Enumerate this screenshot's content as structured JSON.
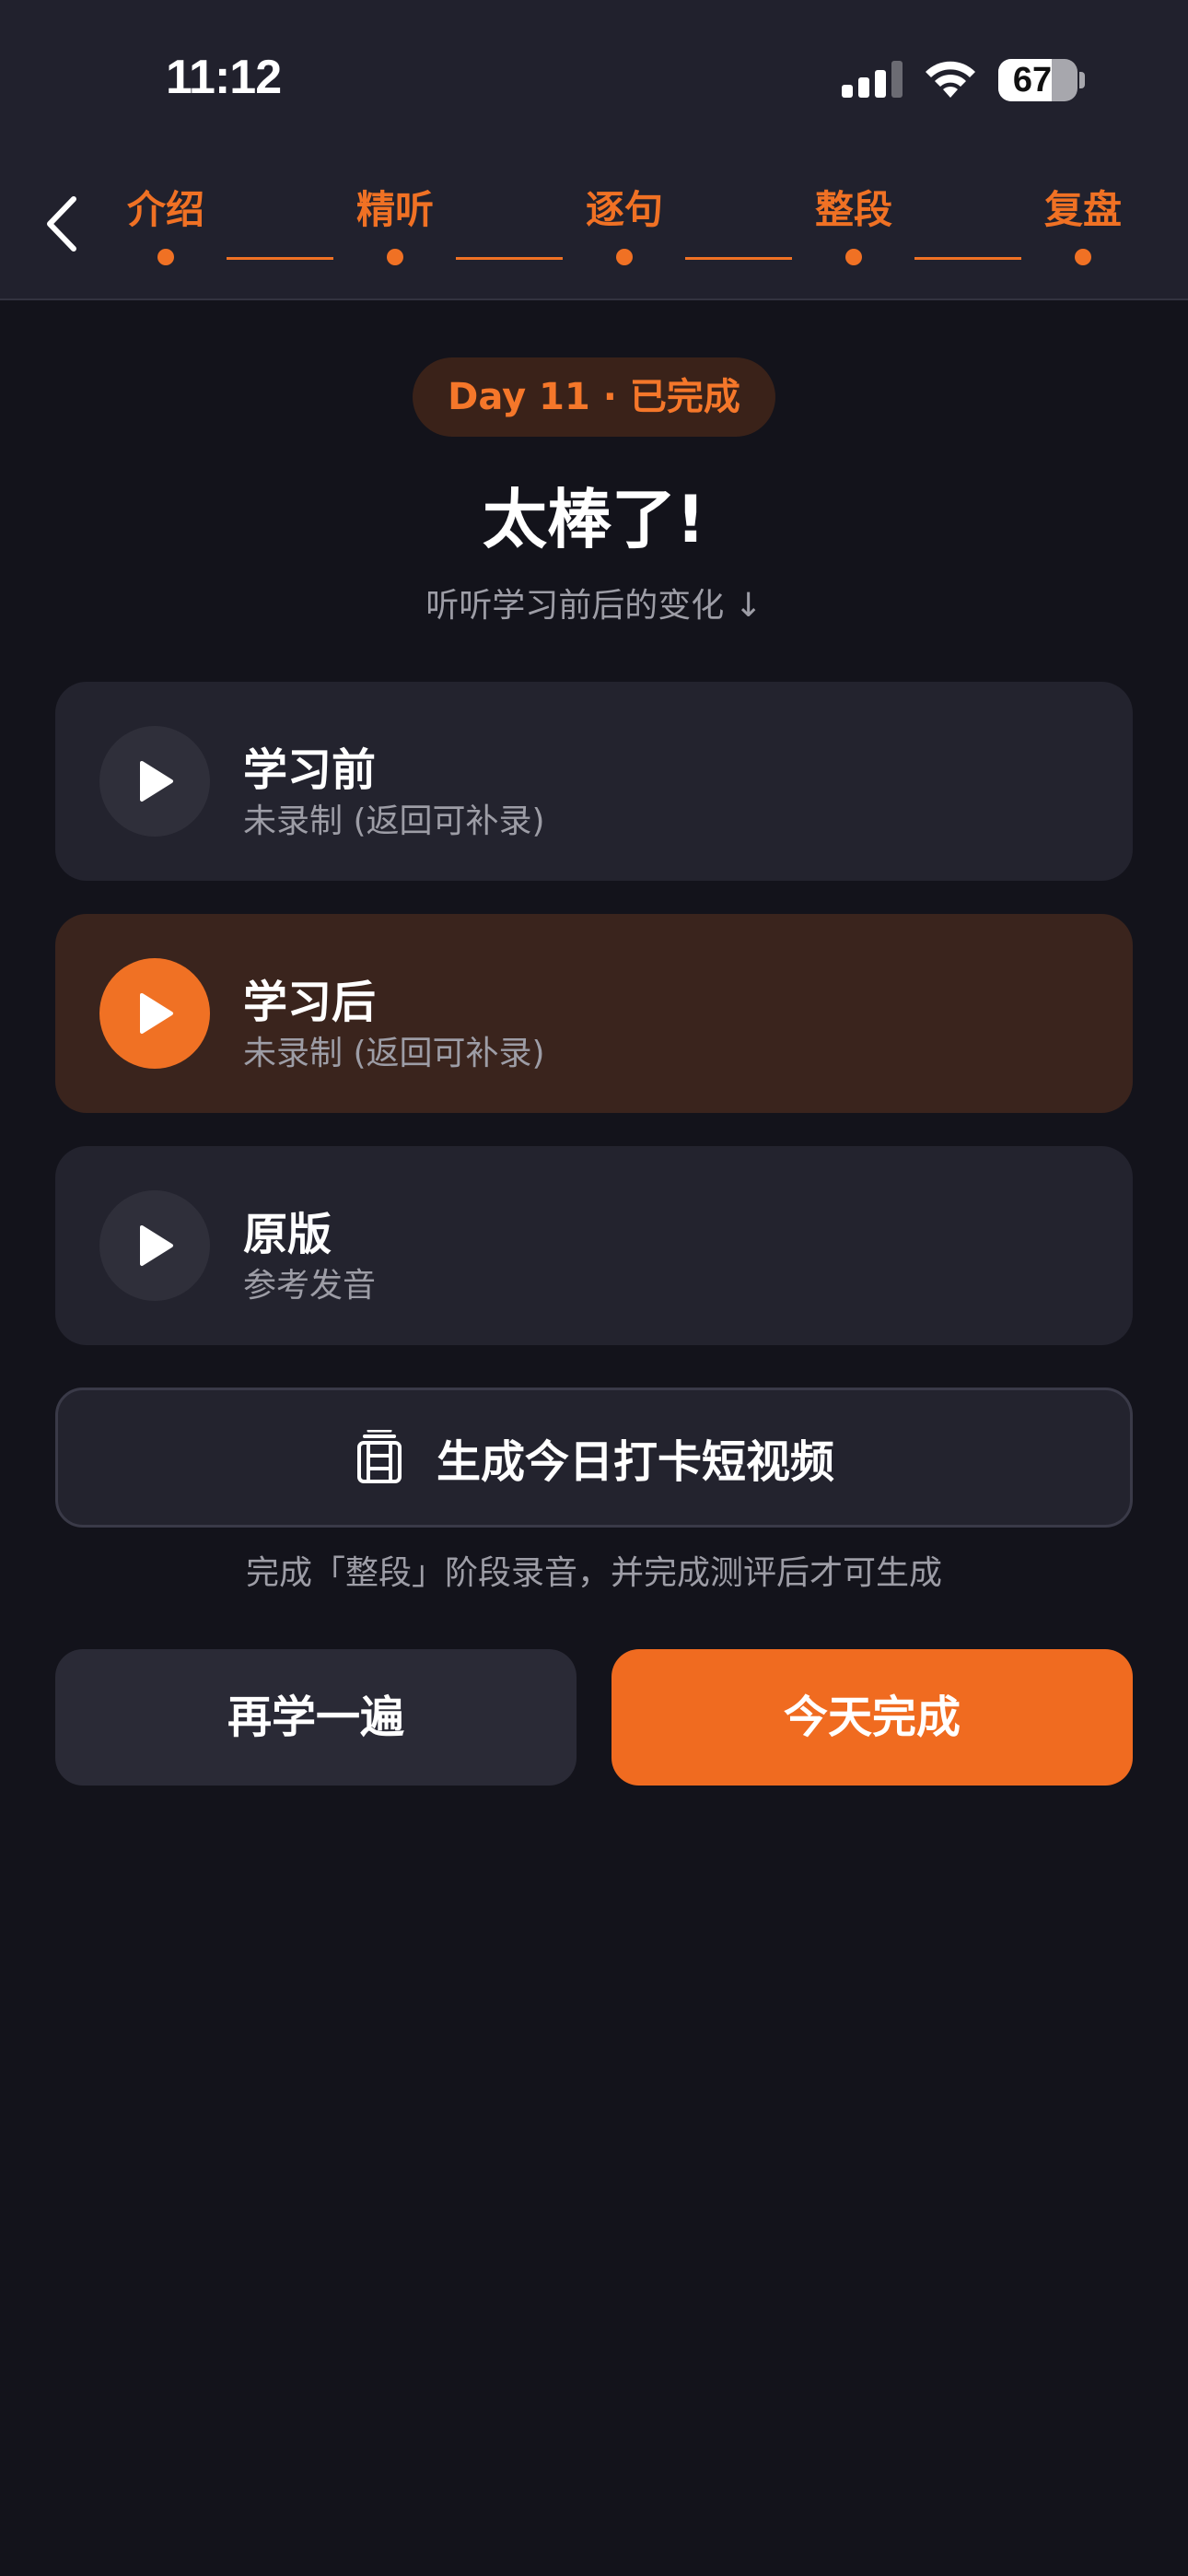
{
  "status_bar": {
    "time": "11:12",
    "battery": "67"
  },
  "steps": [
    {
      "label": "介绍"
    },
    {
      "label": "精听"
    },
    {
      "label": "逐句"
    },
    {
      "label": "整段"
    },
    {
      "label": "复盘"
    }
  ],
  "badge": "Day 11 · 已完成",
  "title": "太棒了!",
  "subtitle": "听听学习前后的变化 ↓",
  "recordings": [
    {
      "title": "学习前",
      "subtitle": "未录制 (返回可补录)"
    },
    {
      "title": "学习后",
      "subtitle": "未录制 (返回可补录)"
    },
    {
      "title": "原版",
      "subtitle": "参考发音"
    }
  ],
  "video_button": {
    "label": "生成今日打卡短视频"
  },
  "hint": "完成「整段」阶段录音，并完成测评后才可生成",
  "actions": {
    "again": "再学一遍",
    "done": "今天完成"
  },
  "colors": {
    "accent": "#f07124",
    "background": "#13131b",
    "card": "#23232e",
    "card_active": "#3a241d"
  },
  "icons": [
    "back-chevron-icon",
    "play-icon",
    "film-icon",
    "signal-icon",
    "wifi-icon",
    "battery-icon"
  ]
}
